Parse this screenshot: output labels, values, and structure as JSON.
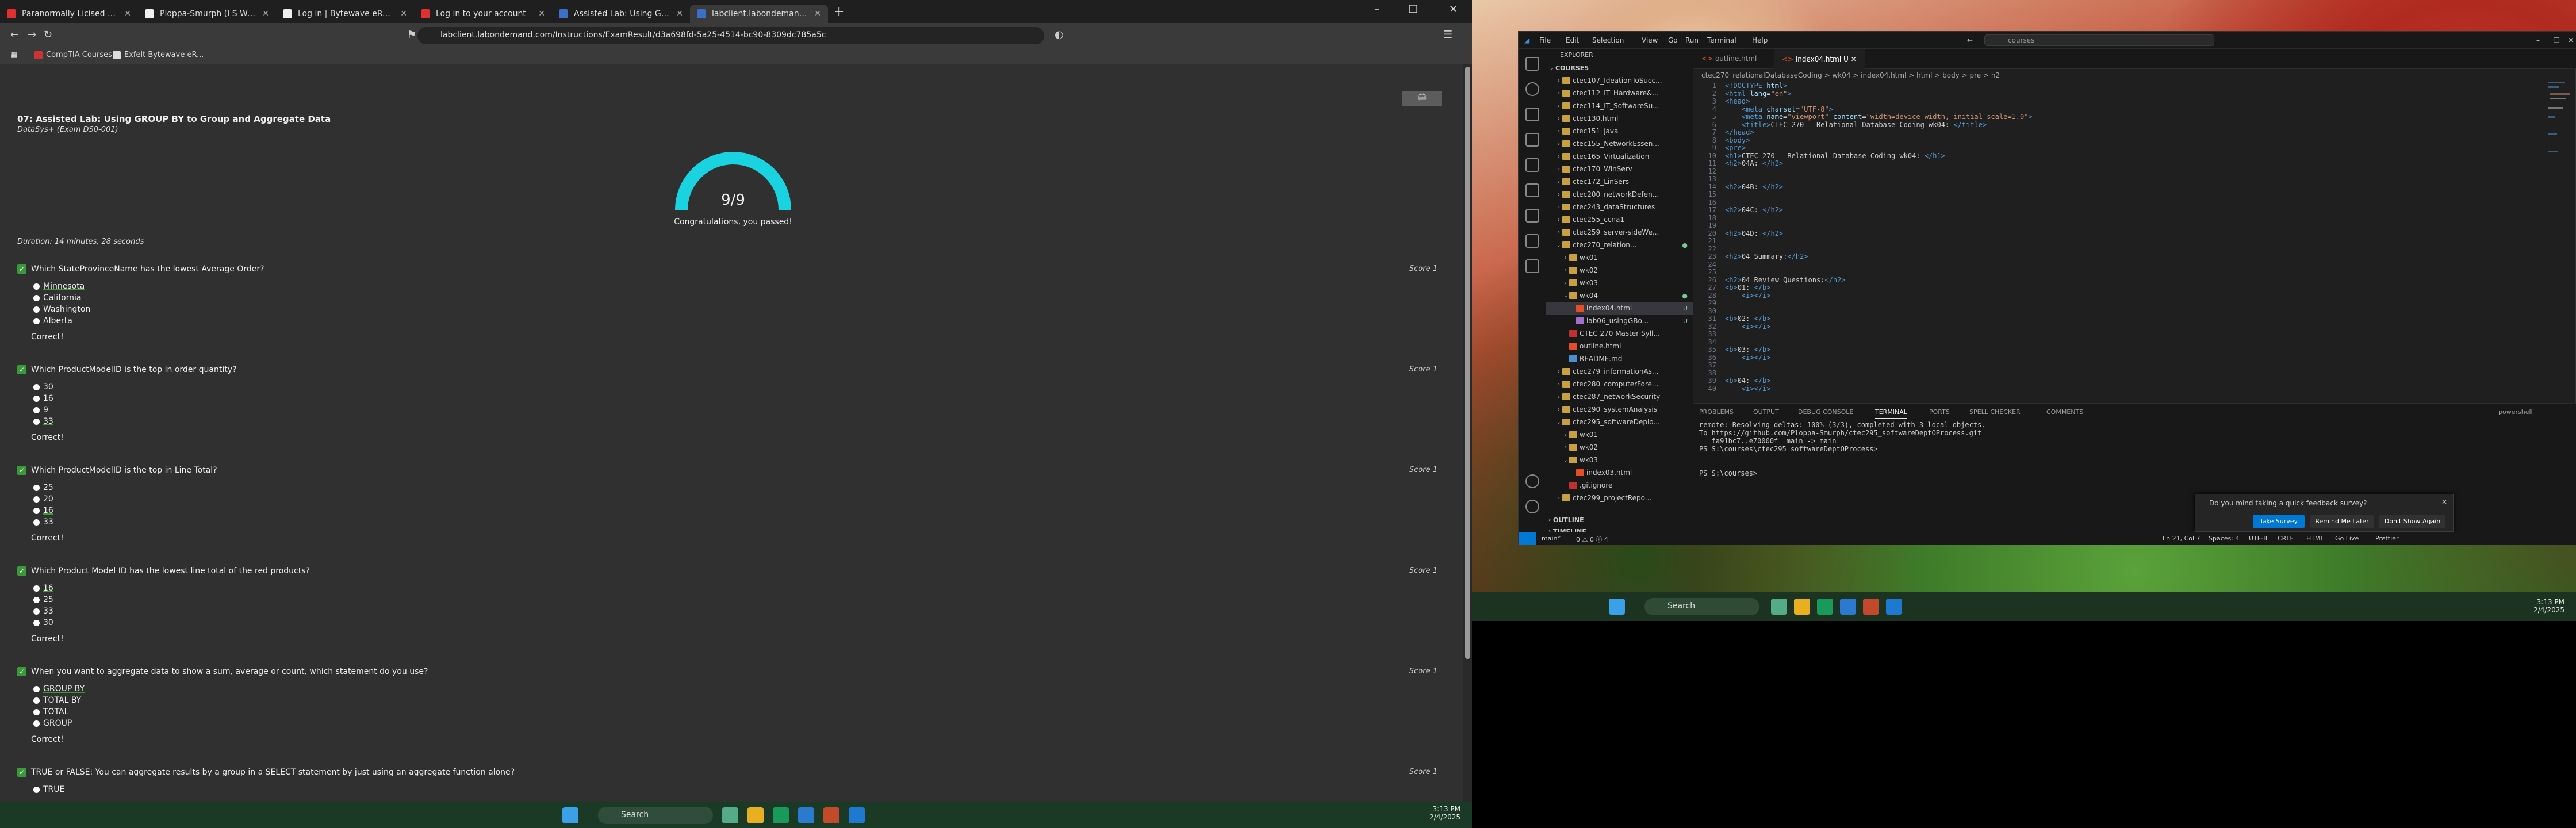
{
  "browser": {
    "tabs": [
      {
        "title": "Paranormally Licised Haunted Pr",
        "color": "#e03030"
      },
      {
        "title": "Ploppa-Smurph (I S Walley)",
        "color": "#f0f0f0"
      },
      {
        "title": "Log in | Bytewave eReader",
        "color": "#f0f0f0"
      },
      {
        "title": "Log in to your account",
        "color": "#e03030"
      },
      {
        "title": "Assisted Lab: Using GROUP BY to G",
        "color": "#3a70c8"
      },
      {
        "title": "labclient.labondemand.com/Ins",
        "color": "#3a70c8"
      }
    ],
    "url": "labclient.labondemand.com/Instructions/ExamResult/d3a698fd-5a25-4514-bc90-8309dc785a5c",
    "bookmarks": [
      "CompTIA Courses",
      "Exfelt Bytewave eR..."
    ],
    "print_label": "🖨"
  },
  "exam": {
    "title": "07: Assisted Lab: Using GROUP BY to Group and Aggregate Data",
    "subtitle": "DataSys+ (Exam DS0-001)",
    "score_text": "9/9",
    "score_fraction": 1.0,
    "passed_text": "Congratulations, you passed!",
    "duration": "Duration: 14 minutes, 28 seconds",
    "questions": [
      {
        "q": "Which StateProvinceName has the lowest Average Order?",
        "score": "Score 1",
        "options": [
          "Minnesota",
          "California",
          "Washington",
          "Alberta"
        ],
        "correct": 0,
        "result": "Correct!"
      },
      {
        "q": "Which ProductModelID is the top in order quantity?",
        "score": "Score 1",
        "options": [
          "30",
          "16",
          "9",
          "33"
        ],
        "correct": 3,
        "result": "Correct!"
      },
      {
        "q": "Which ProductModelID is the top in Line Total?",
        "score": "Score 1",
        "options": [
          "25",
          "20",
          "16",
          "33"
        ],
        "correct": 2,
        "result": "Correct!"
      },
      {
        "q": "Which Product Model ID has the lowest line total of the red products?",
        "score": "Score 1",
        "options": [
          "16",
          "25",
          "33",
          "30"
        ],
        "correct": 0,
        "result": "Correct!"
      },
      {
        "q": "When you want to aggregate data to show a sum, average or count, which statement do you use?",
        "score": "Score 1",
        "options": [
          "GROUP BY",
          "TOTAL BY",
          "TOTAL",
          "GROUP"
        ],
        "correct": 0,
        "result": "Correct!"
      },
      {
        "q": "TRUE or FALSE: You can aggregate results by a group in a SELECT statement by just using an aggregate function alone?",
        "score": "Score 1",
        "options": [
          "TRUE"
        ],
        "correct": -1,
        "result": ""
      }
    ]
  },
  "left_taskbar": {
    "search": "Search",
    "time": "3:13 PM",
    "date": "2/4/2025"
  },
  "vscode": {
    "menu": [
      "File",
      "Edit",
      "Selection",
      "View",
      "Go",
      "Run",
      "Terminal",
      "Help"
    ],
    "search": "courses",
    "explorer_title": "EXPLORER",
    "tree": [
      {
        "label": "COURSES",
        "level": 0,
        "arrow": "⌄",
        "color": ""
      },
      {
        "label": "ctec107_IdeationToSucc...",
        "level": 1,
        "arrow": "›",
        "color": "#c8a040"
      },
      {
        "label": "ctec112_IT_Hardware&...",
        "level": 1,
        "arrow": "›",
        "color": "#c8a040"
      },
      {
        "label": "ctec114_IT_SoftwareSu...",
        "level": 1,
        "arrow": "›",
        "color": "#c8a040"
      },
      {
        "label": "ctec130.html",
        "level": 1,
        "arrow": "›",
        "color": "#c8a040"
      },
      {
        "label": "ctec151_java",
        "level": 1,
        "arrow": "›",
        "color": "#c8a040"
      },
      {
        "label": "ctec155_NetworkEssen...",
        "level": 1,
        "arrow": "›",
        "color": "#c8a040"
      },
      {
        "label": "ctec165_Virtualization",
        "level": 1,
        "arrow": "›",
        "color": "#c8a040"
      },
      {
        "label": "ctec170_WinServ",
        "level": 1,
        "arrow": "›",
        "color": "#c8a040"
      },
      {
        "label": "ctec172_LinSers",
        "level": 1,
        "arrow": "›",
        "color": "#c8a040"
      },
      {
        "label": "ctec200_networkDefen...",
        "level": 1,
        "arrow": "›",
        "color": "#c8a040"
      },
      {
        "label": "ctec243_dataStructures",
        "level": 1,
        "arrow": "›",
        "color": "#c8a040"
      },
      {
        "label": "ctec255_ccna1",
        "level": 1,
        "arrow": "›",
        "color": "#c8a040"
      },
      {
        "label": "ctec259_server-sideWe...",
        "level": 1,
        "arrow": "›",
        "color": "#c8a040"
      },
      {
        "label": "ctec270_relation...",
        "level": 1,
        "arrow": "⌄",
        "color": "#c8a040",
        "badge": "●"
      },
      {
        "label": "wk01",
        "level": 2,
        "arrow": "›",
        "color": "#c8a040"
      },
      {
        "label": "wk02",
        "level": 2,
        "arrow": "›",
        "color": "#c8a040"
      },
      {
        "label": "wk03",
        "level": 2,
        "arrow": "›",
        "color": "#c8a040"
      },
      {
        "label": "wk04",
        "level": 2,
        "arrow": "⌄",
        "color": "#c8a040",
        "badge": "●"
      },
      {
        "label": "index04.html",
        "level": 3,
        "arrow": "",
        "color": "#e44d26",
        "badge": "U",
        "selected": true
      },
      {
        "label": "lab06_usingGBo...",
        "level": 3,
        "arrow": "",
        "color": "#a070d0",
        "badge": "U"
      },
      {
        "label": "CTEC 270 Master Syll...",
        "level": 2,
        "arrow": "",
        "color": "#c03030"
      },
      {
        "label": "outline.html",
        "level": 2,
        "arrow": "",
        "color": "#e44d26"
      },
      {
        "label": "README.md",
        "level": 2,
        "arrow": "",
        "color": "#4a90d0"
      },
      {
        "label": "ctec279_informationAs...",
        "level": 1,
        "arrow": "›",
        "color": "#c8a040"
      },
      {
        "label": "ctec280_computerFore...",
        "level": 1,
        "arrow": "›",
        "color": "#c8a040"
      },
      {
        "label": "ctec287_networkSecurity",
        "level": 1,
        "arrow": "›",
        "color": "#c8a040"
      },
      {
        "label": "ctec290_systemAnalysis",
        "level": 1,
        "arrow": "›",
        "color": "#c8a040"
      },
      {
        "label": "ctec295_softwareDeplo...",
        "level": 1,
        "arrow": "⌄",
        "color": "#c8a040"
      },
      {
        "label": "wk01",
        "level": 2,
        "arrow": "›",
        "color": "#c8a040"
      },
      {
        "label": "wk02",
        "level": 2,
        "arrow": "›",
        "color": "#c8a040"
      },
      {
        "label": "wk03",
        "level": 2,
        "arrow": "⌄",
        "color": "#c8a040"
      },
      {
        "label": "index03.html",
        "level": 3,
        "arrow": "",
        "color": "#e44d26"
      },
      {
        "label": ".gitignore",
        "level": 2,
        "arrow": "",
        "color": "#c03030"
      },
      {
        "label": "ctec299_projectRepo...",
        "level": 1,
        "arrow": "›",
        "color": "#c8a040"
      }
    ],
    "outline": "OUTLINE",
    "timeline": "TIMELINE",
    "tabs": [
      {
        "label": "outline.html",
        "active": false
      },
      {
        "label": "index04.html U",
        "active": true
      }
    ],
    "breadcrumb": "ctec270_relationalDatabaseCoding > wk04 > index04.html > html > body > pre > h2",
    "code": [
      {
        "n": "1",
        "parts": [
          [
            "tg",
            "<!DOCTYPE "
          ],
          [
            "at",
            "html"
          ],
          [
            "tg",
            ">"
          ]
        ]
      },
      {
        "n": "2",
        "parts": [
          [
            "tg",
            "<html "
          ],
          [
            "at",
            "lang"
          ],
          [
            "tx",
            "="
          ],
          [
            "st",
            "\"en\""
          ],
          [
            "tg",
            ">"
          ]
        ]
      },
      {
        "n": "3",
        "parts": [
          [
            "tg",
            "<head>"
          ]
        ]
      },
      {
        "n": "4",
        "parts": [
          [
            "tx",
            "    "
          ],
          [
            "tg",
            "<meta "
          ],
          [
            "at",
            "charset"
          ],
          [
            "tx",
            "="
          ],
          [
            "st",
            "\"UTF-8\""
          ],
          [
            "tg",
            ">"
          ]
        ]
      },
      {
        "n": "5",
        "parts": [
          [
            "tx",
            "    "
          ],
          [
            "tg",
            "<meta "
          ],
          [
            "at",
            "name"
          ],
          [
            "tx",
            "="
          ],
          [
            "st",
            "\"viewport\""
          ],
          [
            "at",
            " content"
          ],
          [
            "tx",
            "="
          ],
          [
            "st",
            "\"width=device-width, initial-scale=1.0\""
          ],
          [
            "tg",
            ">"
          ]
        ]
      },
      {
        "n": "6",
        "parts": [
          [
            "tx",
            "    "
          ],
          [
            "tg",
            "<title>"
          ],
          [
            "tx",
            "CTEC 270 - Relational Database Coding wk04: "
          ],
          [
            "tg",
            "</title>"
          ]
        ]
      },
      {
        "n": "7",
        "parts": [
          [
            "tg",
            "</head>"
          ]
        ]
      },
      {
        "n": "8",
        "parts": [
          [
            "tg",
            "<body>"
          ]
        ]
      },
      {
        "n": "9",
        "parts": [
          [
            "tg",
            "<pre>"
          ]
        ]
      },
      {
        "n": "10",
        "parts": [
          [
            "tg",
            "<h1>"
          ],
          [
            "tx",
            "CTEC 270 - Relational Database Coding wk04: "
          ],
          [
            "tg",
            "</h1>"
          ]
        ]
      },
      {
        "n": "11",
        "parts": [
          [
            "tg",
            "<h2>"
          ],
          [
            "tx",
            "04A: "
          ],
          [
            "tg",
            "</h2>"
          ]
        ]
      },
      {
        "n": "12",
        "parts": []
      },
      {
        "n": "13",
        "parts": []
      },
      {
        "n": "14",
        "parts": [
          [
            "tg",
            "<h2>"
          ],
          [
            "tx",
            "04B: "
          ],
          [
            "tg",
            "</h2>"
          ]
        ]
      },
      {
        "n": "15",
        "parts": []
      },
      {
        "n": "16",
        "parts": []
      },
      {
        "n": "17",
        "parts": [
          [
            "tg",
            "<h2>"
          ],
          [
            "tx",
            "04C: "
          ],
          [
            "tg",
            "</h2>"
          ]
        ]
      },
      {
        "n": "18",
        "parts": []
      },
      {
        "n": "19",
        "parts": []
      },
      {
        "n": "20",
        "parts": [
          [
            "tg",
            "<h2>"
          ],
          [
            "tx",
            "04D: "
          ],
          [
            "tg",
            "</h2>"
          ]
        ]
      },
      {
        "n": "21",
        "parts": []
      },
      {
        "n": "22",
        "parts": []
      },
      {
        "n": "23",
        "parts": [
          [
            "tg",
            "<h2>"
          ],
          [
            "tx",
            "04 Summary:"
          ],
          [
            "tg",
            "</h2>"
          ]
        ]
      },
      {
        "n": "24",
        "parts": []
      },
      {
        "n": "25",
        "parts": []
      },
      {
        "n": "26",
        "parts": [
          [
            "tg",
            "<h2>"
          ],
          [
            "tx",
            "04 Review Questions:"
          ],
          [
            "tg",
            "</h2>"
          ]
        ]
      },
      {
        "n": "27",
        "parts": [
          [
            "tg",
            "<b>"
          ],
          [
            "tx",
            "01: "
          ],
          [
            "tg",
            "</b>"
          ]
        ]
      },
      {
        "n": "28",
        "parts": [
          [
            "tx",
            "    "
          ],
          [
            "tg",
            "<i>"
          ],
          [
            "tg",
            "</i>"
          ]
        ]
      },
      {
        "n": "29",
        "parts": []
      },
      {
        "n": "30",
        "parts": []
      },
      {
        "n": "31",
        "parts": [
          [
            "tg",
            "<b>"
          ],
          [
            "tx",
            "02: "
          ],
          [
            "tg",
            "</b>"
          ]
        ]
      },
      {
        "n": "32",
        "parts": [
          [
            "tx",
            "    "
          ],
          [
            "tg",
            "<i>"
          ],
          [
            "tg",
            "</i>"
          ]
        ]
      },
      {
        "n": "33",
        "parts": []
      },
      {
        "n": "34",
        "parts": []
      },
      {
        "n": "35",
        "parts": [
          [
            "tg",
            "<b>"
          ],
          [
            "tx",
            "03: "
          ],
          [
            "tg",
            "</b>"
          ]
        ]
      },
      {
        "n": "36",
        "parts": [
          [
            "tx",
            "    "
          ],
          [
            "tg",
            "<i>"
          ],
          [
            "tg",
            "</i>"
          ]
        ]
      },
      {
        "n": "37",
        "parts": []
      },
      {
        "n": "38",
        "parts": []
      },
      {
        "n": "39",
        "parts": [
          [
            "tg",
            "<b>"
          ],
          [
            "tx",
            "04: "
          ],
          [
            "tg",
            "</b>"
          ]
        ]
      },
      {
        "n": "40",
        "parts": [
          [
            "tx",
            "    "
          ],
          [
            "tg",
            "<i>"
          ],
          [
            "tg",
            "</i>"
          ]
        ]
      }
    ],
    "panel_tabs": [
      "PROBLEMS",
      "OUTPUT",
      "DEBUG CONSOLE",
      "TERMINAL",
      "PORTS",
      "SPELL CHECKER",
      "COMMENTS"
    ],
    "terminal_label": "powershell",
    "terminal": [
      "remote: Resolving deltas: 100% (3/3), completed with 3 local objects.",
      "To https://github.com/Ploppa-Smurph/ctec295_softwareDeptOProcess.git",
      "   fa91bc7..e70000f  main -> main",
      "PS S:\\courses\\ctec295_softwareDeptOProcess>",
      "",
      "",
      "PS S:\\courses>"
    ],
    "notification": {
      "message": "Do you mind taking a quick feedback survey?",
      "buttons": [
        "Take Survey",
        "Remind Me Later",
        "Don't Show Again"
      ]
    },
    "status": {
      "left": "main*",
      "errors": "0 ⚠ 0 ⓘ 4",
      "position": "Ln 21, Col 7",
      "spaces": "Spaces: 4",
      "encoding": "UTF-8",
      "eol": "CRLF",
      "lang": "HTML",
      "golive": "Go Live",
      "prettier": "Prettier"
    }
  },
  "right_taskbar": {
    "search": "Search",
    "time": "3:13 PM",
    "date": "2/4/2025"
  }
}
